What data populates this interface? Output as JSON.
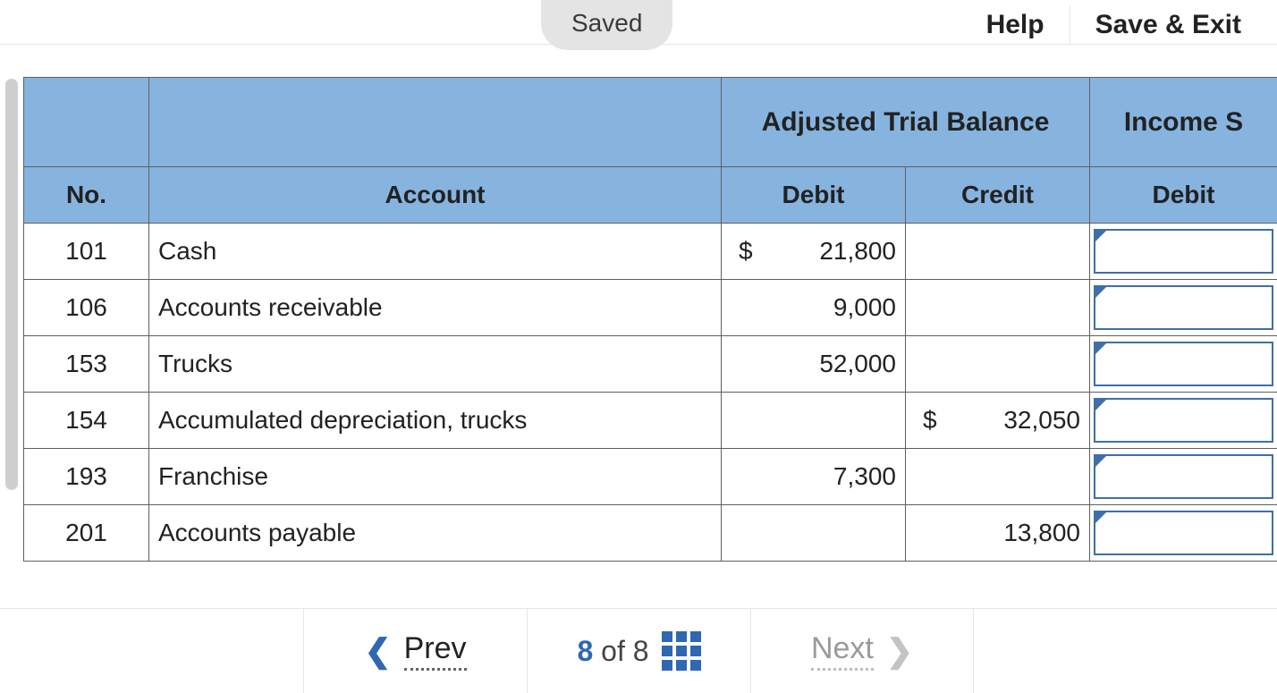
{
  "topbar": {
    "saved_label": "Saved",
    "help_label": "Help",
    "save_exit_label": "Save & Exit"
  },
  "table": {
    "group_headers": {
      "blank1": "",
      "blank2": "",
      "adjusted_trial_balance": "Adjusted Trial Balance",
      "income_statement": "Income S"
    },
    "col_headers": {
      "no": "No.",
      "account": "Account",
      "debit": "Debit",
      "credit": "Credit",
      "is_debit": "Debit"
    },
    "rows": [
      {
        "no": "101",
        "account": "Cash",
        "debit_sym": "$",
        "debit": "21,800",
        "credit_sym": "",
        "credit": ""
      },
      {
        "no": "106",
        "account": "Accounts receivable",
        "debit_sym": "",
        "debit": "9,000",
        "credit_sym": "",
        "credit": ""
      },
      {
        "no": "153",
        "account": "Trucks",
        "debit_sym": "",
        "debit": "52,000",
        "credit_sym": "",
        "credit": ""
      },
      {
        "no": "154",
        "account": "Accumulated depreciation, trucks",
        "debit_sym": "",
        "debit": "",
        "credit_sym": "$",
        "credit": "32,050"
      },
      {
        "no": "193",
        "account": "Franchise",
        "debit_sym": "",
        "debit": "7,300",
        "credit_sym": "",
        "credit": ""
      },
      {
        "no": "201",
        "account": "Accounts payable",
        "debit_sym": "",
        "debit": "",
        "credit_sym": "",
        "credit": "13,800"
      }
    ]
  },
  "nav": {
    "prev_label": "Prev",
    "next_label": "Next",
    "current_page": "8",
    "of_label": "of",
    "total_pages": "8"
  }
}
